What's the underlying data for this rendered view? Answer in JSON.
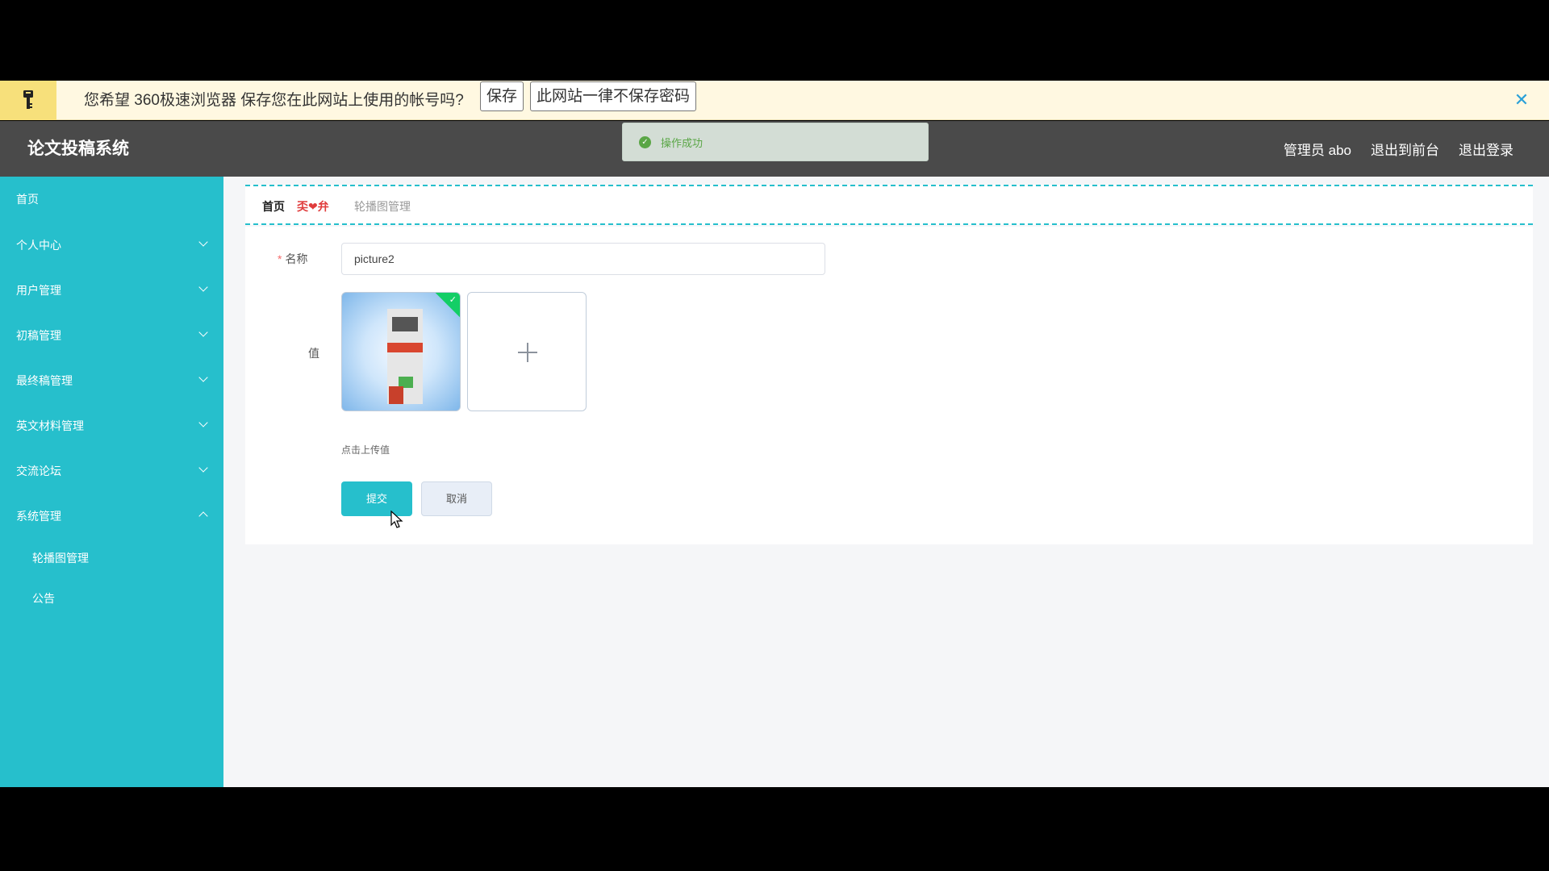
{
  "browser_bar": {
    "message": "您希望 360极速浏览器 保存您在此网站上使用的帐号吗?",
    "save_label": "保存",
    "never_label": "此网站一律不保存密码",
    "close_glyph": "✕"
  },
  "header": {
    "title": "论文投稿系统",
    "user": "管理员 abo",
    "to_front": "退出到前台",
    "logout": "退出登录"
  },
  "toast": {
    "text": "操作成功"
  },
  "sidebar": {
    "items": [
      {
        "label": "首页"
      },
      {
        "label": "个人中心"
      },
      {
        "label": "用户管理"
      },
      {
        "label": "初稿管理"
      },
      {
        "label": "最终稿管理"
      },
      {
        "label": "英文材料管理"
      },
      {
        "label": "交流论坛"
      },
      {
        "label": "系统管理"
      }
    ],
    "subitems": [
      {
        "label": "轮播图管理"
      },
      {
        "label": "公告"
      }
    ]
  },
  "breadcrumb": {
    "home": "首页",
    "separator": "奀❤弁",
    "current": "轮播图管理"
  },
  "form": {
    "name_label": "名称",
    "name_value": "picture2",
    "value_label": "值",
    "upload_hint": "点击上传值",
    "submit_label": "提交",
    "cancel_label": "取消"
  },
  "colors": {
    "accent": "#26bfcc",
    "topbar": "#4a4a4a",
    "toast_bg": "#d3ddd5",
    "success": "#5aa646"
  }
}
